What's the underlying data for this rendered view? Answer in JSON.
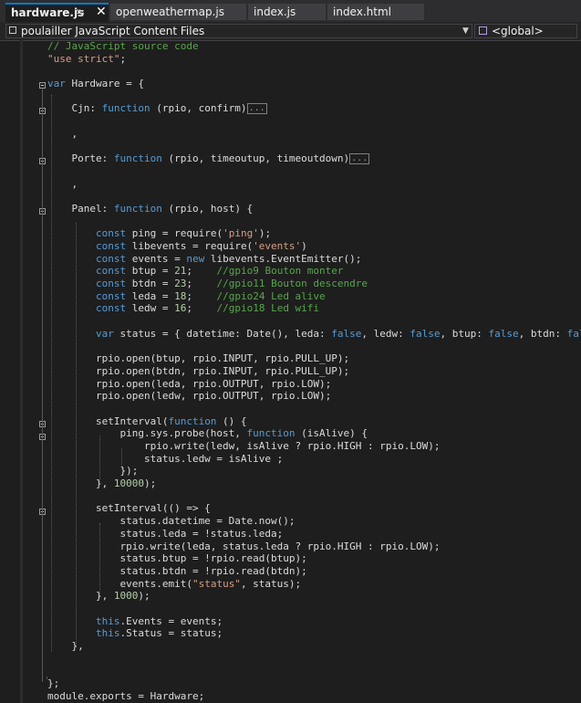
{
  "tabs": [
    {
      "label": "hardware.js",
      "active": true
    },
    {
      "label": "openweathermap.js",
      "active": false
    },
    {
      "label": "index.js",
      "active": false
    },
    {
      "label": "index.html",
      "active": false
    }
  ],
  "tab_icons": {
    "pin": "pin-icon",
    "close": "close-icon"
  },
  "navbar": {
    "project": "poulailler JavaScript Content Files",
    "scope": "<global>"
  },
  "colors": {
    "keyword": "#569cd6",
    "string": "#d69d85",
    "comment": "#57a64a",
    "number": "#b5cea8",
    "text": "#dcdcdc",
    "background": "#1e1e1e",
    "accent": "#007acc"
  },
  "code_lines": [
    "<span class=\"com\">// JavaScript source code</span>",
    "<span class=\"str\">\"use strict\"</span>;",
    "",
    "<span class=\"kw\">var</span> Hardware = {",
    "",
    "    Cjn: <span class=\"kw\">function</span> (rpio, confirm)<span class=\"collapsed\">...</span>",
    "",
    "    ,",
    "",
    "    Porte: <span class=\"kw\">function</span> (rpio, timeoutup, timeoutdown)<span class=\"collapsed\">...</span>",
    "",
    "    ,",
    "",
    "    Panel: <span class=\"kw\">function</span> (rpio, host) {",
    "",
    "        <span class=\"kw\">const</span> ping = require(<span class=\"str\">'ping'</span>);",
    "        <span class=\"kw\">const</span> libevents = require(<span class=\"str\">'events'</span>)",
    "        <span class=\"kw\">const</span> events = <span class=\"kw\">new</span> libevents.EventEmitter();",
    "        <span class=\"kw\">const</span> btup = <span class=\"num\">21</span>;    <span class=\"com\">//gpio9 Bouton monter</span>",
    "        <span class=\"kw\">const</span> btdn = <span class=\"num\">23</span>;    <span class=\"com\">//gpio11 Bouton descendre</span>",
    "        <span class=\"kw\">const</span> leda = <span class=\"num\">18</span>;    <span class=\"com\">//gpio24 Led alive</span>",
    "        <span class=\"kw\">const</span> ledw = <span class=\"num\">16</span>;    <span class=\"com\">//gpio18 Led wifi</span>",
    "",
    "        <span class=\"kw\">var</span> status = { datetime: Date(), leda: <span class=\"kw\">false</span>, ledw: <span class=\"kw\">false</span>, btup: <span class=\"kw\">false</span>, btdn: <span class=\"kw\">false</span> }",
    "",
    "        rpio.open(btup, rpio.INPUT, rpio.PULL_UP);",
    "        rpio.open(btdn, rpio.INPUT, rpio.PULL_UP);",
    "        rpio.open(leda, rpio.OUTPUT, rpio.LOW);",
    "        rpio.open(ledw, rpio.OUTPUT, rpio.LOW);",
    "",
    "        setInterval(<span class=\"kw\">function</span> () {",
    "            ping.sys.probe(host, <span class=\"kw\">function</span> (isAlive) {",
    "                rpio.write(ledw, isAlive ? rpio.HIGH : rpio.LOW);",
    "                status.ledw = isAlive ;",
    "            });",
    "        }, <span class=\"num\">10000</span>);",
    "",
    "        setInterval(() => {",
    "            status.datetime = Date.now();",
    "            status.leda = !status.leda;",
    "            rpio.write(leda, status.leda ? rpio.HIGH : rpio.LOW);",
    "            status.btup = !rpio.read(btup);",
    "            status.btdn = !rpio.read(btdn);",
    "            events.emit(<span class=\"str\">\"status\"</span>, status);",
    "        }, <span class=\"num\">1000</span>);",
    "",
    "        <span class=\"kw\">this</span>.Events = events;",
    "        <span class=\"kw\">this</span>.Status = status;",
    "    },",
    "",
    "",
    "};",
    "module.exports = Hardware;"
  ]
}
